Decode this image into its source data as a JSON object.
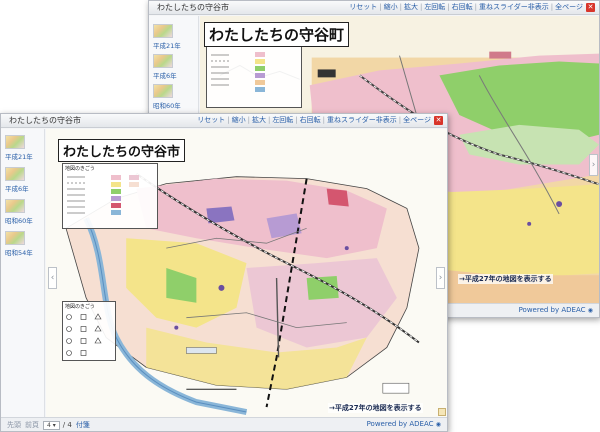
{
  "toolbar": {
    "reset": "リセット",
    "zoom_out": "縮小",
    "zoom_in": "拡大",
    "rotate_left": "左回転",
    "rotate_right": "右回転",
    "slider_toggle": "重ねスライダー非表示",
    "all": "全ページ"
  },
  "back_window": {
    "title": "わたしたちの守谷市",
    "map_title": "わたしたちの守谷町",
    "hint": "→平成27年の地図を表示する",
    "powered_by": "Powered by ADEAC",
    "thumbnails": [
      {
        "label": "平成21年"
      },
      {
        "label": "平成6年"
      },
      {
        "label": "昭和60年"
      }
    ]
  },
  "front_window": {
    "title": "わたしたちの守谷市",
    "map_title": "わたしたちの守谷市",
    "hint": "→平成27年の地図を表示する",
    "powered_by": "Powered by ADEAC",
    "legend_title": "地図のきごう",
    "thumbnails": [
      {
        "label": "平成21年"
      },
      {
        "label": "平成6年"
      },
      {
        "label": "昭和60年"
      },
      {
        "label": "昭和54年"
      }
    ],
    "pager": {
      "first": "先頭",
      "prev": "前頁",
      "current": "4",
      "total": "/ 4",
      "attachment": "付箋"
    }
  },
  "colors": {
    "link": "#2a5fa8",
    "close": "#d8352a",
    "map_pink": "#efbfcc",
    "map_yellow": "#f4e48a",
    "map_green": "#8fcf6a",
    "map_river": "#8ab6d8"
  }
}
